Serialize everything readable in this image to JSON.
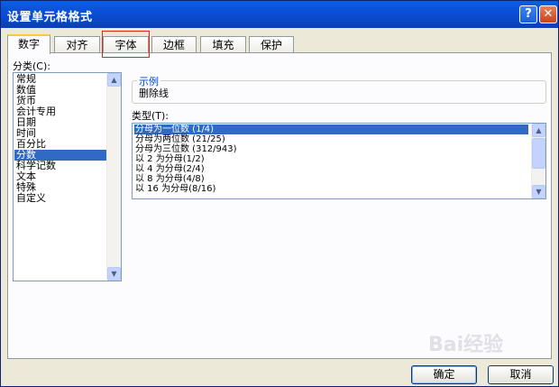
{
  "dialog": {
    "title": "设置单元格格式",
    "help_glyph": "?",
    "close_glyph": "✕"
  },
  "tabs": [
    {
      "label": "数字",
      "active": true
    },
    {
      "label": "对齐",
      "active": false
    },
    {
      "label": "字体",
      "active": false
    },
    {
      "label": "边框",
      "active": false
    },
    {
      "label": "填充",
      "active": false
    },
    {
      "label": "保护",
      "active": false
    }
  ],
  "category": {
    "label": "分类(C):",
    "items": [
      "常规",
      "数值",
      "货币",
      "会计专用",
      "日期",
      "时间",
      "百分比",
      "分数",
      "科学记数",
      "文本",
      "特殊",
      "自定义"
    ],
    "selected_index": 7
  },
  "sample": {
    "title": "示例",
    "value": "删除线"
  },
  "type": {
    "label": "类型(T):",
    "items": [
      "分母为一位数 (1/4)",
      "分母为两位数 (21/25)",
      "分母为三位数 (312/943)",
      "以 2 为分母(1/2)",
      "以 4 为分母(2/4)",
      "以 8 为分母(4/8)",
      "以 16 为分母(8/16)"
    ],
    "selected_index": 0
  },
  "buttons": {
    "ok": "确定",
    "cancel": "取消"
  },
  "watermark": "Bai经验",
  "colors": {
    "title_bar": "#0b4fd8",
    "selection": "#316ac5",
    "highlight_box": "#e0231e",
    "dialog_bg": "#ece9d8"
  },
  "icons": {
    "help": "question-icon",
    "close": "close-icon",
    "scroll_up": "chevron-up-icon",
    "scroll_down": "chevron-down-icon"
  }
}
